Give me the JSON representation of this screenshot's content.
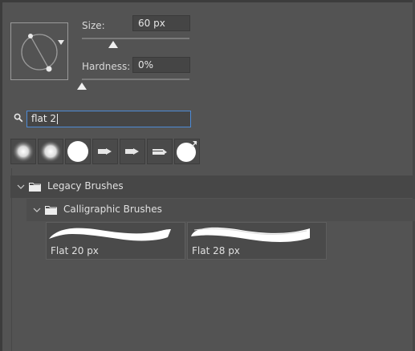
{
  "brush_settings": {
    "size_label": "Size:",
    "size_value": "60 px",
    "hardness_label": "Hardness:",
    "hardness_value": "0%"
  },
  "search": {
    "value": "flat 2"
  },
  "recent_brushes": [
    {
      "icon": "soft-round-brush-icon"
    },
    {
      "icon": "soft-round-brush-icon"
    },
    {
      "icon": "hard-round-brush-icon"
    },
    {
      "icon": "flat-tip-brush-icon"
    },
    {
      "icon": "flat-tip-brush-icon"
    },
    {
      "icon": "calligraphic-brush-icon"
    },
    {
      "icon": "round-brush-expand-icon"
    }
  ],
  "tree": {
    "group1": "Legacy Brushes",
    "group2": "Calligraphic Brushes"
  },
  "brushes": [
    {
      "label": "Flat 20 px"
    },
    {
      "label": "Flat 28 px"
    }
  ],
  "colors": {
    "panel_bg": "#535353",
    "input_bg": "#454545",
    "focus_border": "#4d8bd6",
    "text": "#d6d6d6"
  }
}
